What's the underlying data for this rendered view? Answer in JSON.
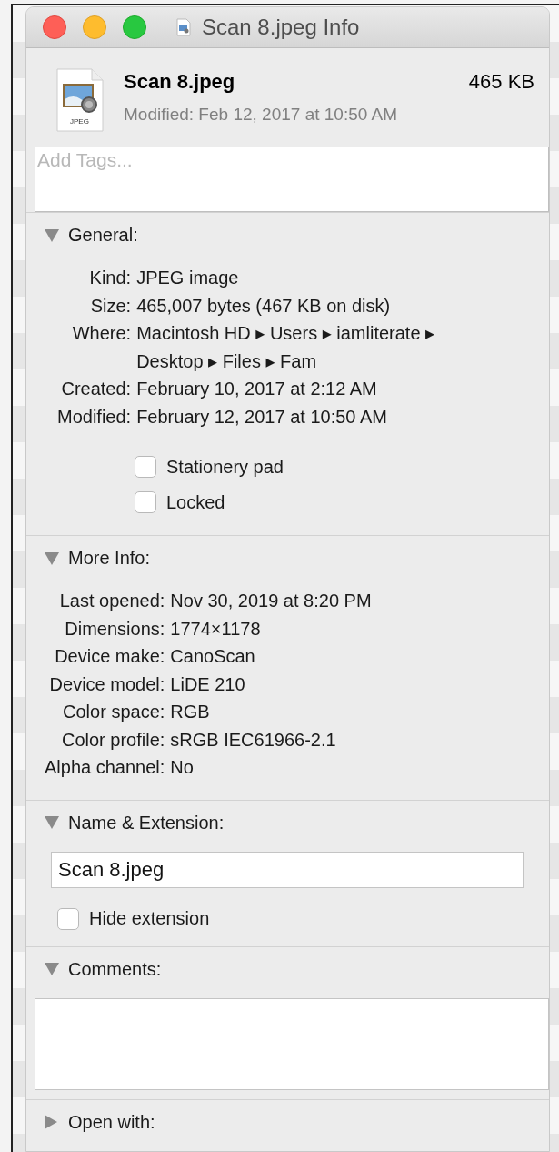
{
  "window": {
    "title": "Scan 8.jpeg Info"
  },
  "header": {
    "name": "Scan 8.jpeg",
    "size": "465 KB",
    "modified": "Modified: Feb 12, 2017 at 10:50 AM",
    "icon_label": "JPEG"
  },
  "tags": {
    "placeholder": "Add Tags..."
  },
  "sections": [
    {
      "kind": "info",
      "title": "General:",
      "expanded": true,
      "rows": [
        {
          "label": "Kind:",
          "value": "JPEG image"
        },
        {
          "label": "Size:",
          "value": "465,007 bytes (467 KB on disk)"
        },
        {
          "label": "Where:",
          "value": "Macintosh HD ▸ Users ▸ iamliterate ▸ Desktop ▸ Files ▸ Fam"
        },
        {
          "label": "Created:",
          "value": "February 10, 2017 at 2:12 AM"
        },
        {
          "label": "Modified:",
          "value": "February 12, 2017 at 10:50 AM"
        }
      ],
      "checkboxes": [
        {
          "label": "Stationery pad",
          "checked": false
        },
        {
          "label": "Locked",
          "checked": false
        }
      ]
    },
    {
      "kind": "info",
      "title": "More Info:",
      "expanded": true,
      "rows": [
        {
          "label": "Last opened:",
          "value": "Nov 30, 2019 at 8:20 PM"
        },
        {
          "label": "Dimensions:",
          "value": "1774×1178"
        },
        {
          "label": "Device make:",
          "value": "CanoScan"
        },
        {
          "label": "Device model:",
          "value": "LiDE 210"
        },
        {
          "label": "Color space:",
          "value": "RGB"
        },
        {
          "label": "Color profile:",
          "value": "sRGB IEC61966-2.1"
        },
        {
          "label": "Alpha channel:",
          "value": "No"
        }
      ]
    },
    {
      "kind": "name",
      "title": "Name & Extension:",
      "expanded": true,
      "value": "Scan 8.jpeg",
      "checkboxes": [
        {
          "label": "Hide extension",
          "checked": false
        }
      ]
    },
    {
      "kind": "comments",
      "title": "Comments:",
      "expanded": true
    },
    {
      "kind": "other",
      "title": "Open with:",
      "expanded": false
    }
  ]
}
